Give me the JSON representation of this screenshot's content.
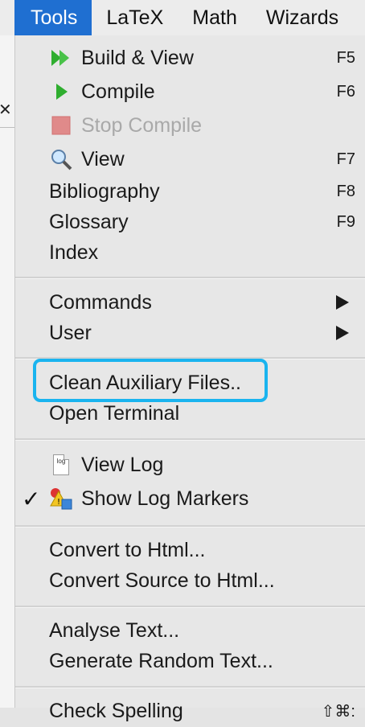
{
  "menubar": {
    "items": [
      "Tools",
      "LaTeX",
      "Math",
      "Wizards"
    ]
  },
  "menu": {
    "build_view": {
      "label": "Build & View",
      "shortcut": "F5"
    },
    "compile": {
      "label": "Compile",
      "shortcut": "F6"
    },
    "stop_compile": {
      "label": "Stop Compile"
    },
    "view": {
      "label": "View",
      "shortcut": "F7"
    },
    "bibliography": {
      "label": "Bibliography",
      "shortcut": "F8"
    },
    "glossary": {
      "label": "Glossary",
      "shortcut": "F9"
    },
    "index": {
      "label": "Index"
    },
    "commands": {
      "label": "Commands"
    },
    "user": {
      "label": "User"
    },
    "clean_aux": {
      "label": "Clean Auxiliary Files.."
    },
    "open_terminal": {
      "label": "Open Terminal"
    },
    "view_log": {
      "label": "View Log",
      "icon_text": "log"
    },
    "show_log_markers": {
      "label": "Show Log Markers",
      "checkmark": "✓"
    },
    "convert_html": {
      "label": "Convert to Html..."
    },
    "convert_source_html": {
      "label": "Convert Source to Html..."
    },
    "analyse_text": {
      "label": "Analyse Text..."
    },
    "generate_random": {
      "label": "Generate Random Text..."
    },
    "check_spelling": {
      "label": "Check Spelling",
      "shortcut": "⇧⌘:"
    }
  },
  "colors": {
    "menubar_active": "#1f6fd1",
    "highlight_border": "#1ab4ef",
    "play_icon": "#2fae2f",
    "stop_icon": "#e08a8a"
  }
}
